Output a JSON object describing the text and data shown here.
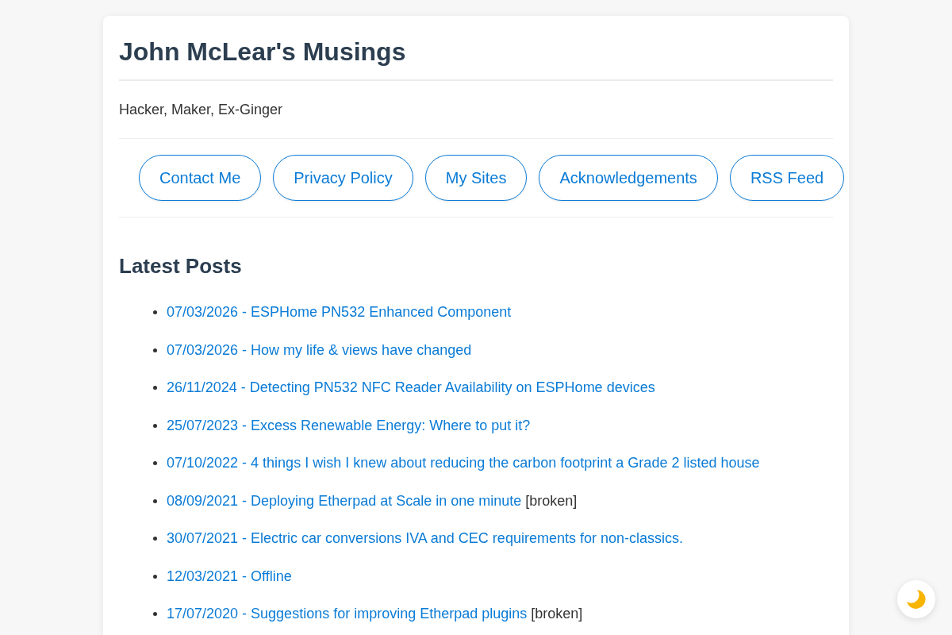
{
  "site": {
    "title": "John McLear's Musings",
    "tagline": "Hacker, Maker, Ex-Ginger"
  },
  "nav_links": [
    "Contact Me",
    "Privacy Policy",
    "My Sites",
    "Acknowledgements",
    "RSS Feed"
  ],
  "latest_posts": {
    "heading": "Latest Posts",
    "posts": [
      {
        "link": "07/03/2026 - ESPHome PN532 Enhanced Component"
      },
      {
        "link": "07/03/2026 - How my life & views have changed"
      },
      {
        "link": "26/11/2024 - Detecting PN532 NFC Reader Availability on ESPHome devices"
      },
      {
        "link": "25/07/2023 - Excess Renewable Energy: Where to put it?"
      },
      {
        "link": "07/10/2022 - 4 things I wish I knew about reducing the carbon footprint a Grade 2 listed house"
      },
      {
        "link": "08/09/2021 - Deploying Etherpad at Scale in one minute",
        "note": "[broken]"
      },
      {
        "link": "30/07/2021 - Electric car conversions IVA and CEC requirements for non-classics."
      },
      {
        "link": "12/03/2021 - Offline"
      },
      {
        "link": "17/07/2020 - Suggestions for improving Etherpad plugins",
        "note": "[broken]"
      }
    ]
  }
}
